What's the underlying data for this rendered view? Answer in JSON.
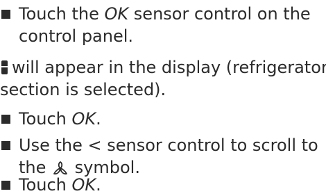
{
  "steps": [
    {
      "line1_pre": "Touch the ",
      "line1_em": "OK",
      "line1_post": " sensor control on the",
      "line2": "control panel."
    },
    {
      "icon": "refrigerator-section-icon",
      "line1": "will appear in the display (refrigerator",
      "line2": "section is selected)."
    },
    {
      "pre": "Touch ",
      "em": "OK",
      "post": "."
    },
    {
      "line1_pre": "Use the ",
      "chevron": "<",
      "line1_post": " sensor control to scroll to",
      "line2_pre": "the ",
      "icon": "fan-icon",
      "line2_post": " symbol."
    },
    {
      "pre": "Touch ",
      "em": "OK",
      "post": "."
    }
  ],
  "colors": {
    "text": "#2b2b2b",
    "background": "#ffffff"
  }
}
